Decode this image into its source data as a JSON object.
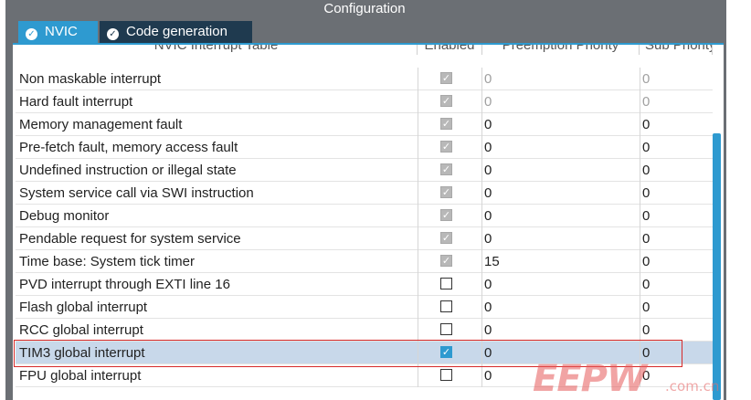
{
  "window": {
    "title": "Configuration"
  },
  "tabs": [
    {
      "label": "NVIC",
      "icon": "check-circle-icon",
      "active": true
    },
    {
      "label": "Code generation",
      "icon": "check-circle-icon",
      "active": false
    }
  ],
  "table": {
    "columns": [
      "NVIC Interrupt Table",
      "Enabled",
      "Preemption Priority",
      "Sub Priority"
    ],
    "rows": [
      {
        "name": "Non maskable interrupt",
        "enabled": true,
        "editable": false,
        "preemption": "0",
        "sub": "0"
      },
      {
        "name": "Hard fault interrupt",
        "enabled": true,
        "editable": false,
        "preemption": "0",
        "sub": "0"
      },
      {
        "name": "Memory management fault",
        "enabled": true,
        "editable": false,
        "preemption": "0",
        "sub": "0"
      },
      {
        "name": "Pre-fetch fault, memory access fault",
        "enabled": true,
        "editable": false,
        "preemption": "0",
        "sub": "0"
      },
      {
        "name": "Undefined instruction or illegal state",
        "enabled": true,
        "editable": false,
        "preemption": "0",
        "sub": "0"
      },
      {
        "name": "System service call via SWI instruction",
        "enabled": true,
        "editable": false,
        "preemption": "0",
        "sub": "0"
      },
      {
        "name": "Debug monitor",
        "enabled": true,
        "editable": false,
        "preemption": "0",
        "sub": "0"
      },
      {
        "name": "Pendable request for system service",
        "enabled": true,
        "editable": false,
        "preemption": "0",
        "sub": "0"
      },
      {
        "name": "Time base: System tick timer",
        "enabled": true,
        "editable": false,
        "preemption": "15",
        "sub": "0"
      },
      {
        "name": "PVD interrupt through EXTI line 16",
        "enabled": false,
        "editable": true,
        "preemption": "0",
        "sub": "0"
      },
      {
        "name": "Flash global interrupt",
        "enabled": false,
        "editable": true,
        "preemption": "0",
        "sub": "0"
      },
      {
        "name": "RCC global interrupt",
        "enabled": false,
        "editable": true,
        "preemption": "0",
        "sub": "0"
      },
      {
        "name": "TIM3 global interrupt",
        "enabled": true,
        "editable": true,
        "preemption": "0",
        "sub": "0",
        "selected": true
      },
      {
        "name": "FPU global interrupt",
        "enabled": false,
        "editable": true,
        "preemption": "0",
        "sub": "0"
      }
    ]
  },
  "watermark": {
    "logo": "EEPW",
    "url": ".com.cn"
  },
  "colors": {
    "accent": "#2e9ad0",
    "frame": "#6b6f74",
    "selected_row": "#c8d8ea",
    "highlight_box": "#d62a2a"
  }
}
